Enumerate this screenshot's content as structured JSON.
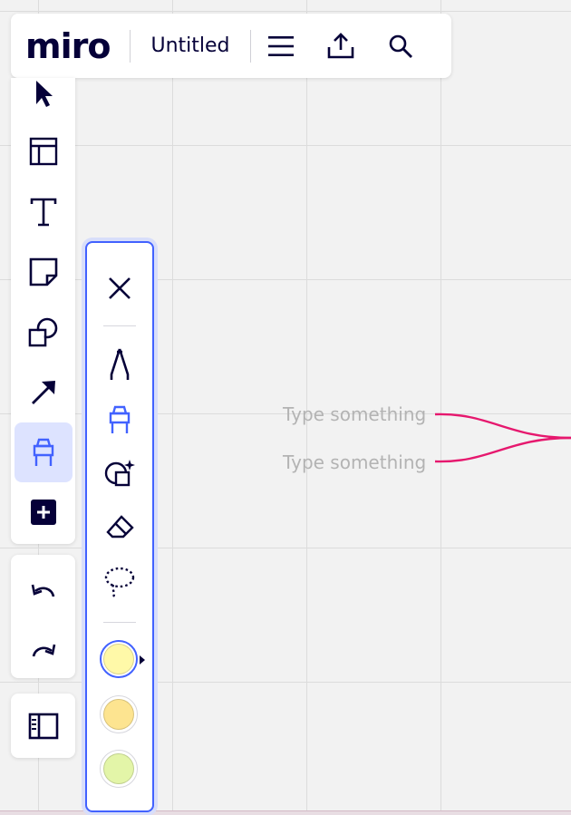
{
  "app": {
    "logo": "miro",
    "board_title": "Untitled"
  },
  "topbar": {
    "icons": [
      "menu-icon",
      "upload-icon",
      "search-icon"
    ]
  },
  "toolbar": {
    "tools": [
      "select-cursor-icon",
      "templates-icon",
      "text-icon",
      "sticky-note-icon",
      "shapes-icon",
      "connection-line-icon",
      "pen-icon",
      "more-tools-icon"
    ],
    "active_tool": "pen-icon"
  },
  "history": {
    "icons": [
      "undo-icon",
      "redo-icon"
    ]
  },
  "pen_panel": {
    "tools": [
      "close-icon",
      "pen-icon",
      "highlighter-icon",
      "smart-drawing-icon",
      "eraser-icon",
      "lasso-icon"
    ],
    "active_tool": "highlighter-icon",
    "colors": [
      "#fff9a8",
      "#fde490",
      "#e3f5a8"
    ],
    "selected_color": 0
  },
  "canvas": {
    "text_nodes": [
      "Type something",
      "Type something"
    ],
    "connector_color": "#e6186e"
  }
}
